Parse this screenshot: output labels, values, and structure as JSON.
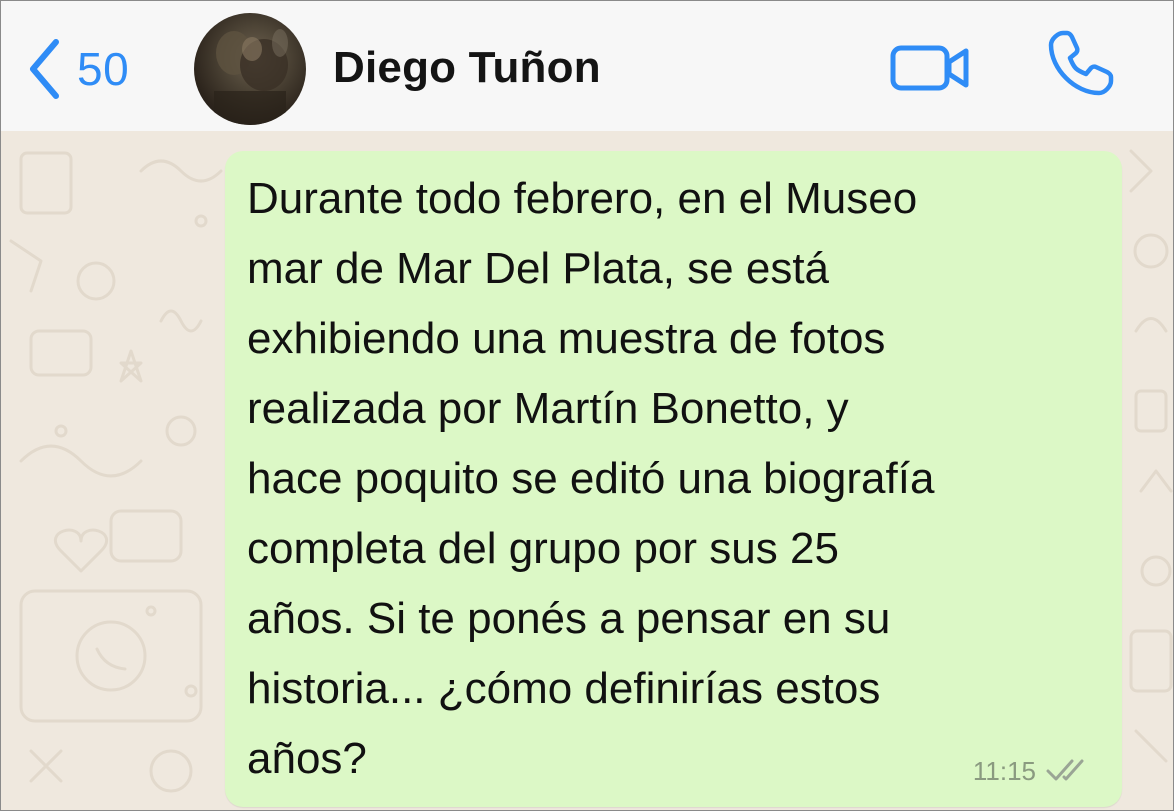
{
  "header": {
    "back_count": "50",
    "contact_name": "Diego Tuñon",
    "icons": {
      "back": "chevron-left-icon",
      "video": "video-camera-icon",
      "call": "phone-icon"
    },
    "accent_color": "#2f8cf6"
  },
  "message": {
    "lines": [
      "Durante todo febrero, en el Museo",
      "mar de Mar Del Plata, se está",
      "exhibiendo una muestra de fotos",
      "realizada por Martín Bonetto, y",
      "hace poquito se editó una biografía",
      "completa del grupo por sus 25",
      "años. Si te ponés a pensar en su",
      "historia... ¿cómo definirías estos",
      "años?"
    ],
    "time": "11:15",
    "status_icon": "double-check-icon",
    "bubble_color": "#dcf8c6"
  },
  "chat_background_color": "#efe8de"
}
